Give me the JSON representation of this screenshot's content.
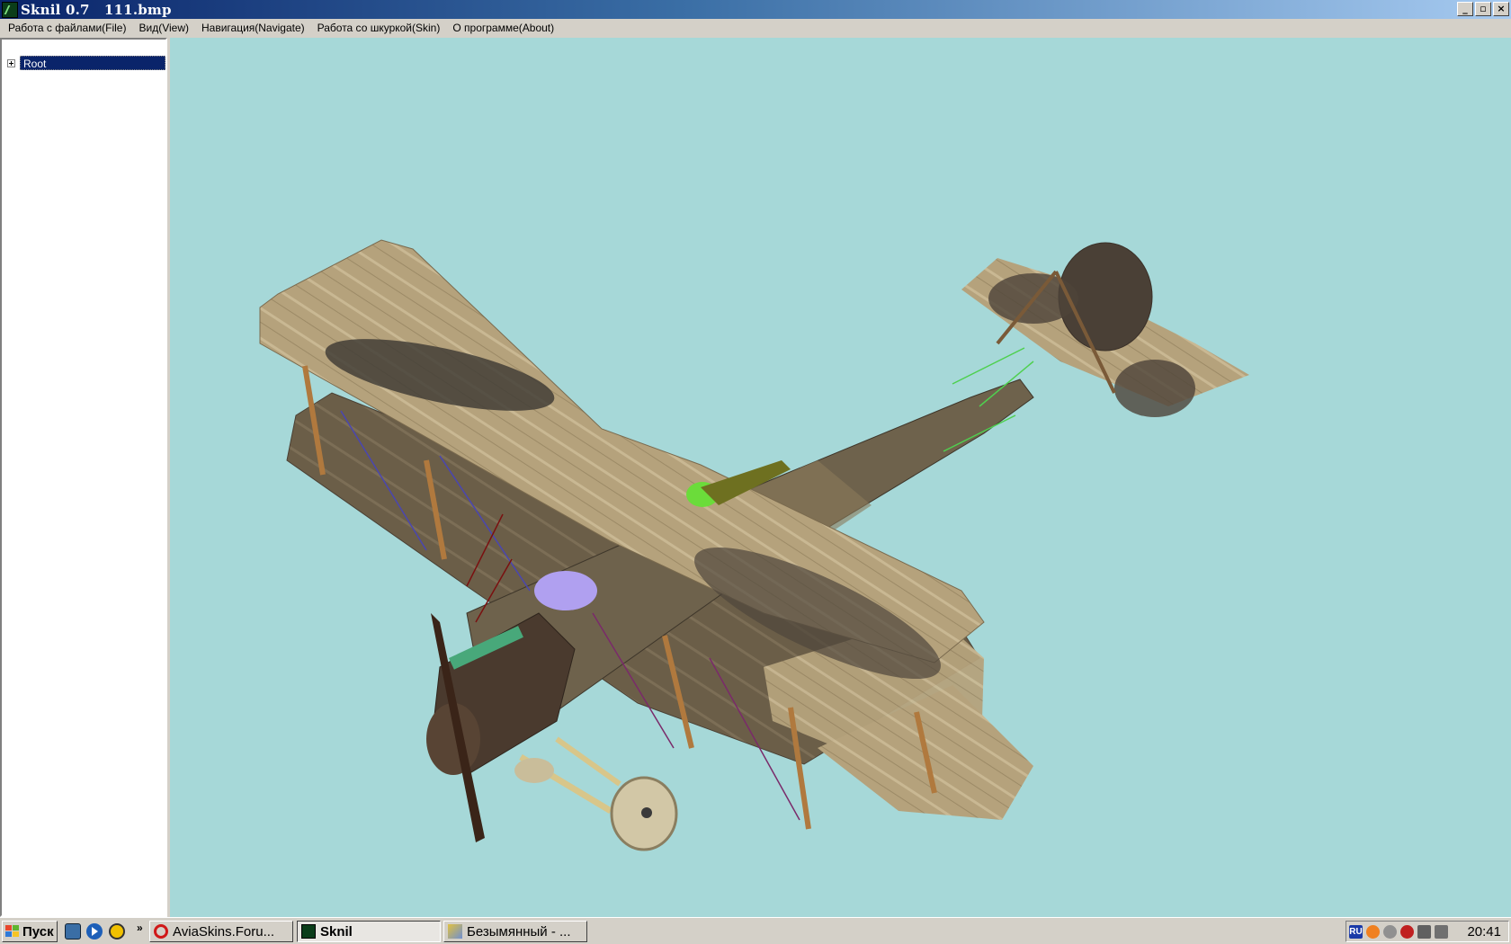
{
  "window": {
    "title": "Sknil 0.7   111.bmp",
    "controls": [
      "_",
      "▫",
      "×"
    ]
  },
  "menu": {
    "items": [
      "Работа с файлами(File)",
      "Вид(View)",
      "Навигация(Navigate)",
      "Работа со шкуркой(Skin)",
      "О программе(About)"
    ]
  },
  "tree": {
    "root_label": "Root",
    "root_expanded": false
  },
  "viewport": {
    "background_color": "#a6d8d8",
    "content": "3D biplane model"
  },
  "taskbar": {
    "start_label": "Пуск",
    "quick_launch_chevron": "»",
    "tasks": [
      {
        "label": "AviaSkins.Foru...",
        "icon": "opera-icon",
        "active": false
      },
      {
        "label": "Sknil",
        "icon": "sknil-icon",
        "active": true
      },
      {
        "label": "Безымянный - ...",
        "icon": "paint-icon",
        "active": false
      }
    ],
    "tray": {
      "language": "RU",
      "clock": "20:41"
    }
  }
}
